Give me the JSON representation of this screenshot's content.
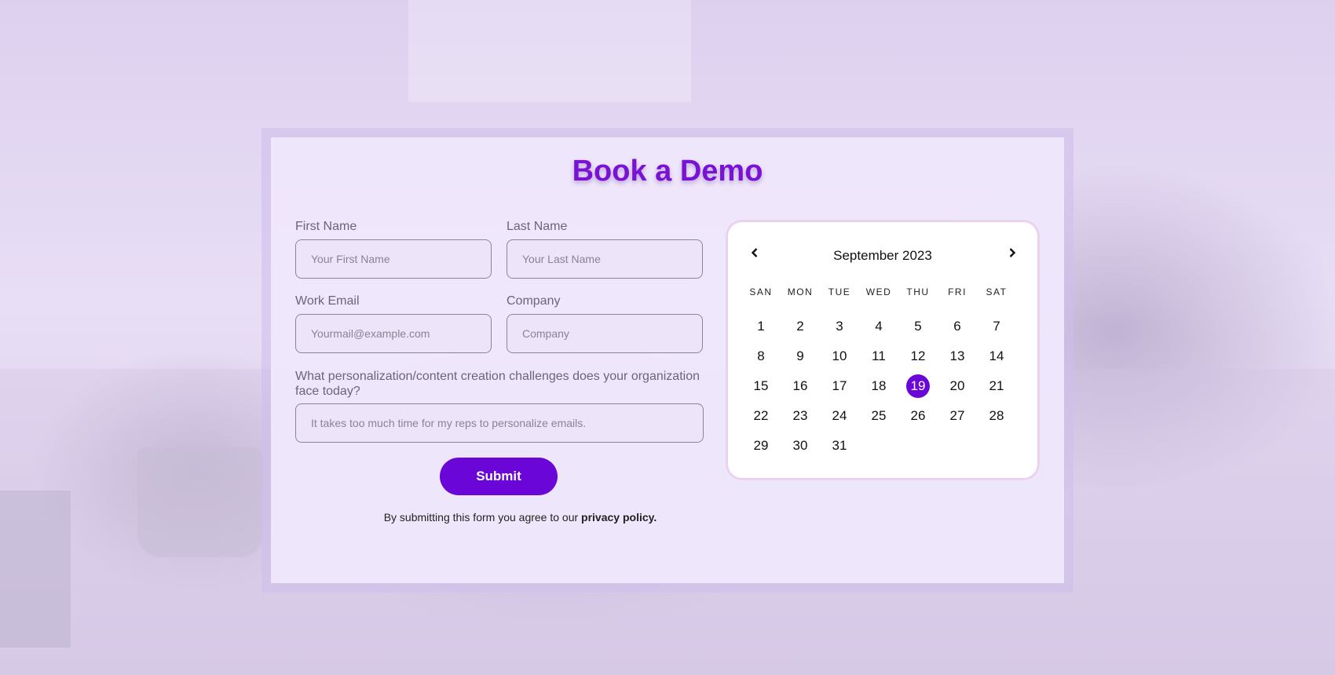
{
  "form": {
    "title": "Book a Demo",
    "first_name_label": "First Name",
    "first_name_placeholder": "Your First Name",
    "last_name_label": "Last Name",
    "last_name_placeholder": "Your Last Name",
    "email_label": "Work Email",
    "email_placeholder": "Yourmail@example.com",
    "company_label": "Company",
    "company_placeholder": "Company",
    "challenge_label": "What personalization/content creation challenges does your organization face today?",
    "challenge_placeholder": "It takes too much time for my reps to personalize emails.",
    "submit_label": "Submit",
    "agree_text": "By submitting this form you agree to our ",
    "privacy_link": "privacy policy."
  },
  "calendar": {
    "month_label": "September 2023",
    "prev_icon": "chevron-left-icon",
    "next_icon": "chevron-right-icon",
    "weekdays": [
      "SAN",
      "MON",
      "TUE",
      "WED",
      "THU",
      "FRI",
      "SAT"
    ],
    "first_weekday_index": 0,
    "days_in_month": 31,
    "selected_day": 19,
    "accent": "#6a06d8"
  },
  "colors": {
    "title": "#7a12d4",
    "accent": "#6a06d8"
  }
}
